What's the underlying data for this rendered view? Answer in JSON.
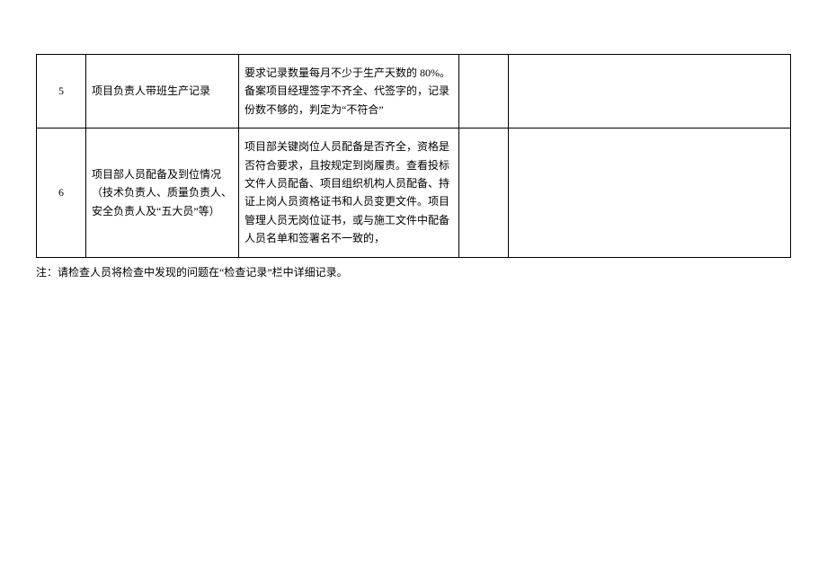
{
  "table": {
    "rows": [
      {
        "num": "5",
        "item": "项目负责人带班生产记录",
        "desc": "要求记录数量每月不少于生产天数的 80%。备案项目经理签字不齐全、代签字的，记录份数不够的，判定为“不符合”",
        "c4": "",
        "c5": ""
      },
      {
        "num": "6",
        "item": "项目部人员配备及到位情况（技术负责人、质量负责人、安全负责人及“五大员”等）",
        "desc": "项目部关键岗位人员配备是否齐全，资格是否符合要求，且按规定到岗履责。查看投标文件人员配备、项目组织机构人员配备、持证上岗人员资格证书和人员变更文件。项目管理人员无岗位证书，或与施工文件中配备人员名单和签署名不一致的，",
        "c4": "",
        "c5": ""
      }
    ]
  },
  "note": "注：请检查人员将检查中发现的问题在“检查记录”栏中详细记录。"
}
